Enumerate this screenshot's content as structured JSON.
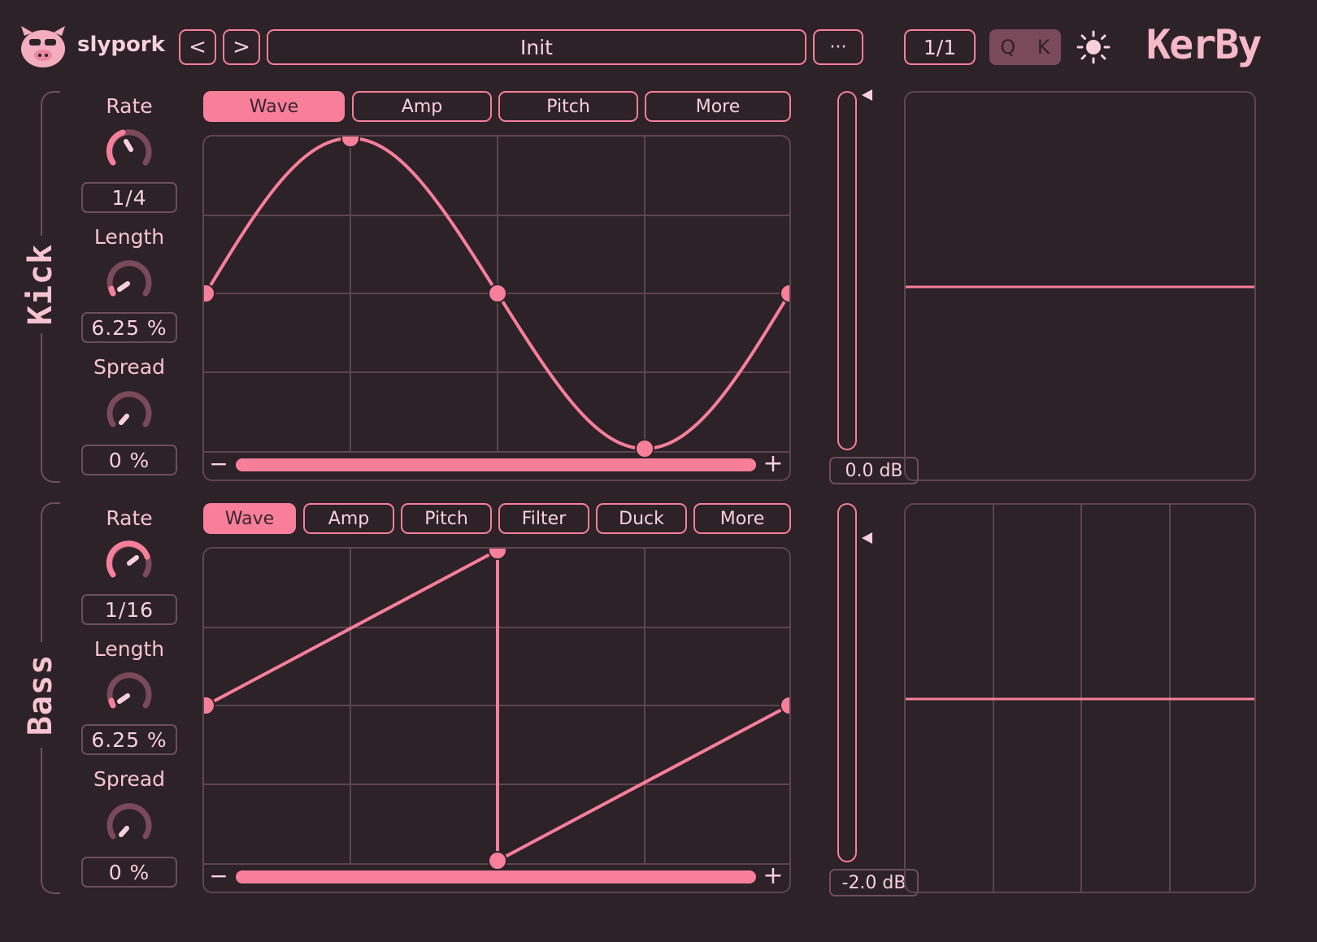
{
  "header": {
    "brand": "slypork",
    "prev_label": "<",
    "next_label": ">",
    "preset_name": "Init",
    "more_label": "···",
    "ratio_label": "1/1",
    "q_label": "Q",
    "k_label": "K",
    "product_name": "KerBy"
  },
  "kick": {
    "name": "Kick",
    "tabs": [
      "Wave",
      "Amp",
      "Pitch",
      "More"
    ],
    "active_tab": "Wave",
    "rate_label": "Rate",
    "rate_value": "1/4",
    "length_label": "Length",
    "length_value": "6.25 %",
    "spread_label": "Spread",
    "spread_value": "0 %",
    "level_db": "0.0 dB",
    "minus_label": "−",
    "plus_label": "+"
  },
  "bass": {
    "name": "Bass",
    "tabs": [
      "Wave",
      "Amp",
      "Pitch",
      "Filter",
      "Duck",
      "More"
    ],
    "active_tab": "Wave",
    "rate_label": "Rate",
    "rate_value": "1/16",
    "length_label": "Length",
    "length_value": "6.25 %",
    "spread_label": "Spread",
    "spread_value": "0 %",
    "level_db": "-2.0 dB",
    "minus_label": "−",
    "plus_label": "+"
  },
  "colors": {
    "background": "#2c2227",
    "accent": "#f77f9a",
    "text": "#f8d0dc",
    "grid": "#5e4550"
  },
  "icons": [
    "pig-logo-icon",
    "sun-icon",
    "chevron-left-icon",
    "chevron-right-icon",
    "ellipsis-icon"
  ]
}
